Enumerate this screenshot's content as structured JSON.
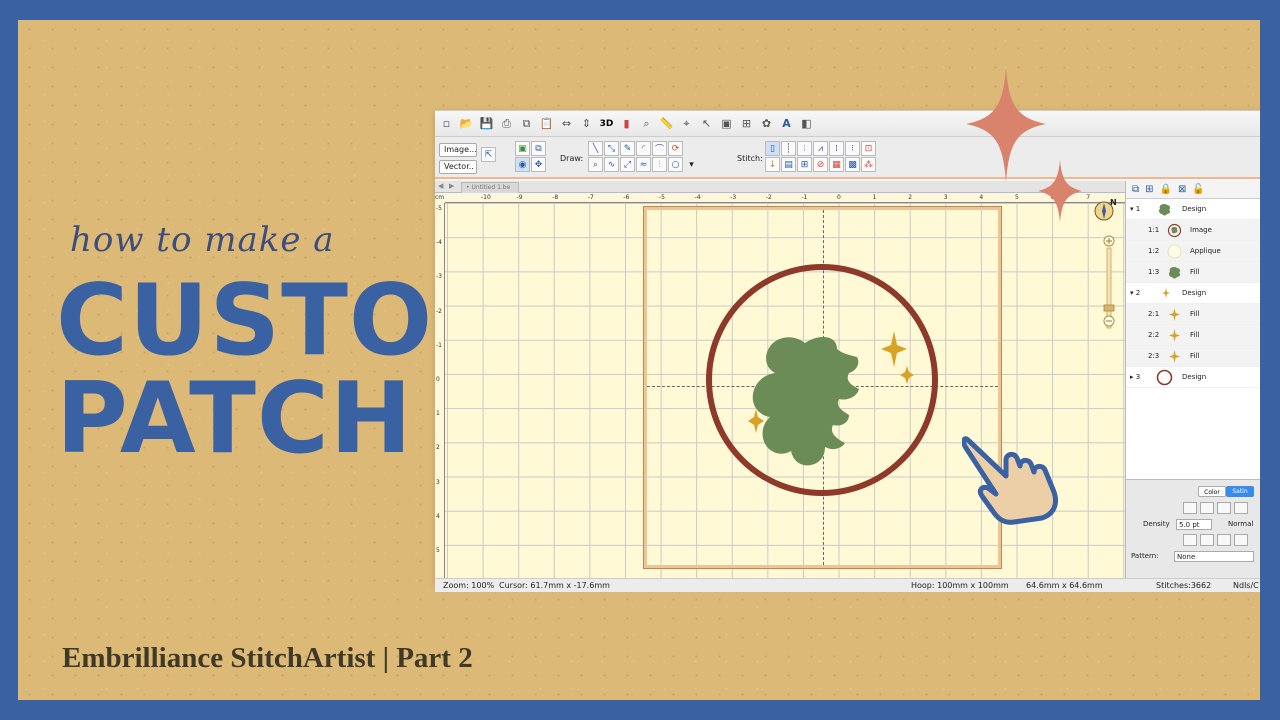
{
  "thumbnail": {
    "pre_title": "how to make a",
    "title_line1": "CUSTOM",
    "title_line2": "PATCH",
    "subtitle": "Embrilliance StitchArtist | Part 2"
  },
  "colors": {
    "border_blue": "#3a62a3",
    "kraft_background": "#ddb977",
    "sparkle_coral": "#d9826c",
    "patch_border": "#8e3a2b",
    "leaf_green": "#6b8c57",
    "star_gold": "#d8a227",
    "canvas_cream": "#fff9d6"
  },
  "app": {
    "toolbar_icons": [
      "new-icon",
      "open-icon",
      "save-icon",
      "print-icon",
      "copy-icon",
      "paste-icon",
      "mirror-h-icon",
      "mirror-v-icon",
      "3d-icon",
      "chart-icon",
      "magnify-icon",
      "ruler-icon",
      "hoop-icon",
      "cursor-icon",
      "select-icon",
      "grid-icon",
      "color-icon",
      "text-icon",
      "lettering-icon"
    ],
    "three_d_label": "3D",
    "image_button": "Image...",
    "vector_button": "Vector..",
    "draw_label": "Draw:",
    "stitch_label": "Stitch:",
    "tab_label": "• Untitled 1.be",
    "ruler_unit": "cm",
    "ruler_top_ticks": [
      "-10",
      "-9",
      "-8",
      "-7",
      "-6",
      "-5",
      "-4",
      "-3",
      "-2",
      "-1",
      "0",
      "1",
      "2",
      "3",
      "4",
      "5",
      "6",
      "7"
    ],
    "ruler_left_ticks": [
      "-5",
      "-4",
      "-3",
      "-2",
      "-1",
      "0",
      "1",
      "2",
      "3",
      "4",
      "5"
    ],
    "compass_label": "N",
    "status": {
      "zoom": "Zoom: 100%",
      "cursor": "Cursor: 61.7mm x -17.6mm",
      "hoop": "Hoop: 100mm x 100mm",
      "size": "64.6mm x 64.6mm",
      "stitches": "Stitches:3662",
      "needles": "Ndls/C"
    },
    "tree": [
      {
        "num": "1",
        "label": "Design",
        "level": 0,
        "thumb": "leaf"
      },
      {
        "num": "1:1",
        "label": "Image",
        "level": 1,
        "thumb": "image"
      },
      {
        "num": "1:2",
        "label": "Applique",
        "level": 1,
        "thumb": "circle"
      },
      {
        "num": "1:3",
        "label": "Fill",
        "level": 1,
        "thumb": "leaf"
      },
      {
        "num": "2",
        "label": "Design",
        "level": 0,
        "thumb": "stars"
      },
      {
        "num": "2:1",
        "label": "Fill",
        "level": 1,
        "thumb": "star"
      },
      {
        "num": "2:2",
        "label": "Fill",
        "level": 1,
        "thumb": "star"
      },
      {
        "num": "2:3",
        "label": "Fill",
        "level": 1,
        "thumb": "star"
      },
      {
        "num": "3",
        "label": "Design",
        "level": 0,
        "thumb": "ring"
      }
    ],
    "props": {
      "color_tab": "Color",
      "satin_tab": "Satin",
      "density_label": "Density",
      "density_value": "5.0 pt",
      "normal_label": "Normal",
      "pattern_label": "Pattern:",
      "pattern_value": "None"
    }
  }
}
